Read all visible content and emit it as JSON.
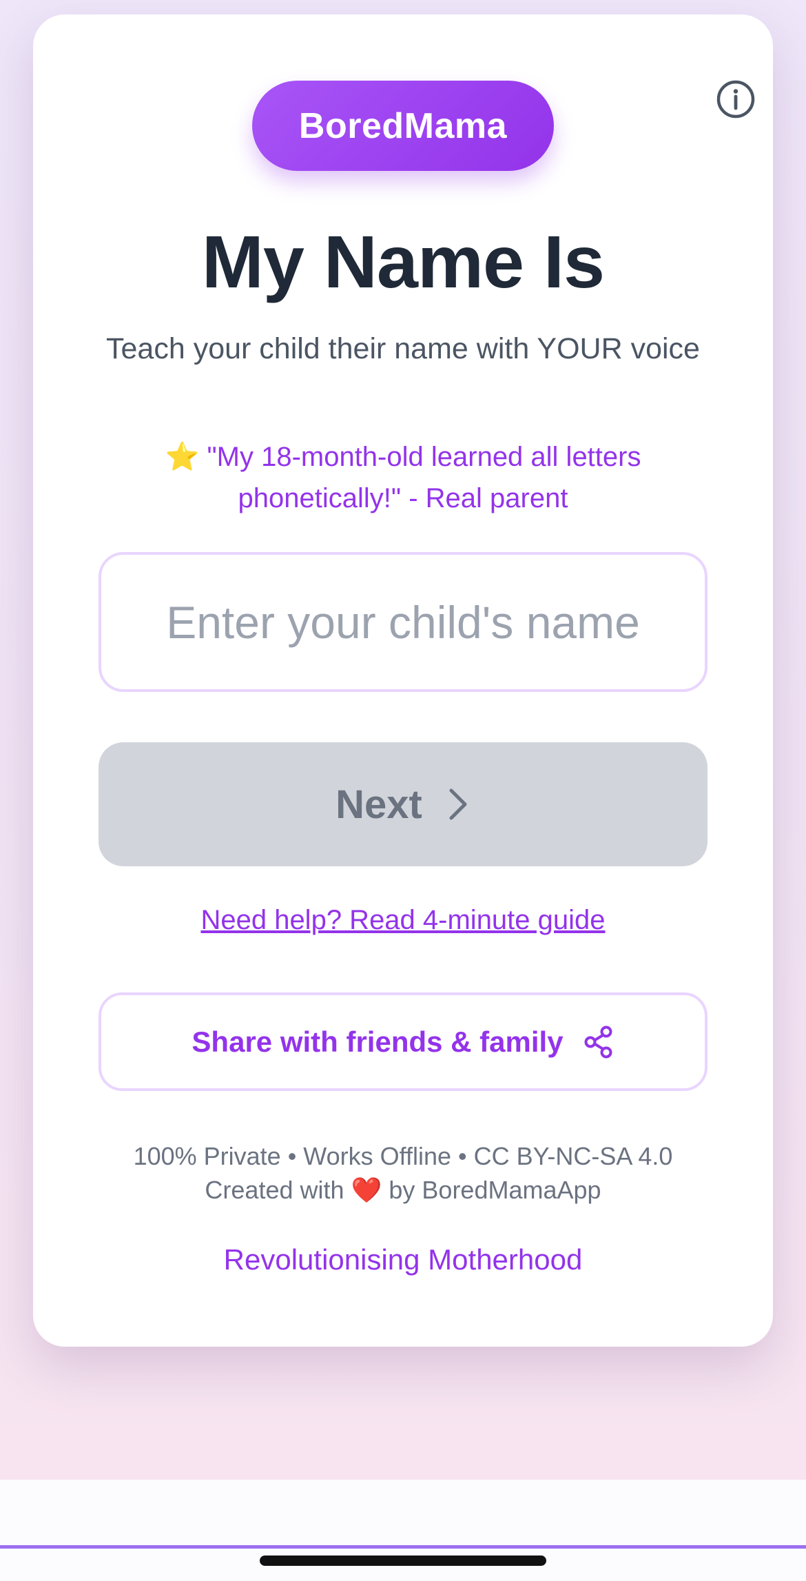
{
  "brand": {
    "name": "BoredMama"
  },
  "header": {
    "title": "My Name Is",
    "subtitle": "Teach your child their name with YOUR voice",
    "testimonial_icon": "⭐",
    "testimonial": "\"My 18-month-old learned all letters phonetically!\" - Real parent"
  },
  "form": {
    "name_value": "",
    "name_placeholder": "Enter your child's name",
    "next_label": "Next"
  },
  "help": {
    "link_label": "Need help? Read 4-minute guide"
  },
  "share": {
    "label": "Share with friends & family"
  },
  "footer": {
    "line1": "100% Private • Works Offline • CC BY-NC-SA 4.0",
    "line2_before": "Created with",
    "heart": "❤️",
    "line2_after": "by BoredMamaApp",
    "tagline": "Revolutionising Motherhood"
  },
  "icons": {
    "info": "info-circle-icon",
    "next": "chevron-right-icon",
    "share": "share-nodes-icon",
    "star": "star-icon",
    "heart": "heart-icon"
  },
  "colors": {
    "accent": "#9333ea",
    "accent_light": "#a855f7",
    "title": "#1f2937",
    "muted": "#6b7280",
    "disabled_button": "#d1d5db",
    "input_border": "#e9d5ff"
  }
}
